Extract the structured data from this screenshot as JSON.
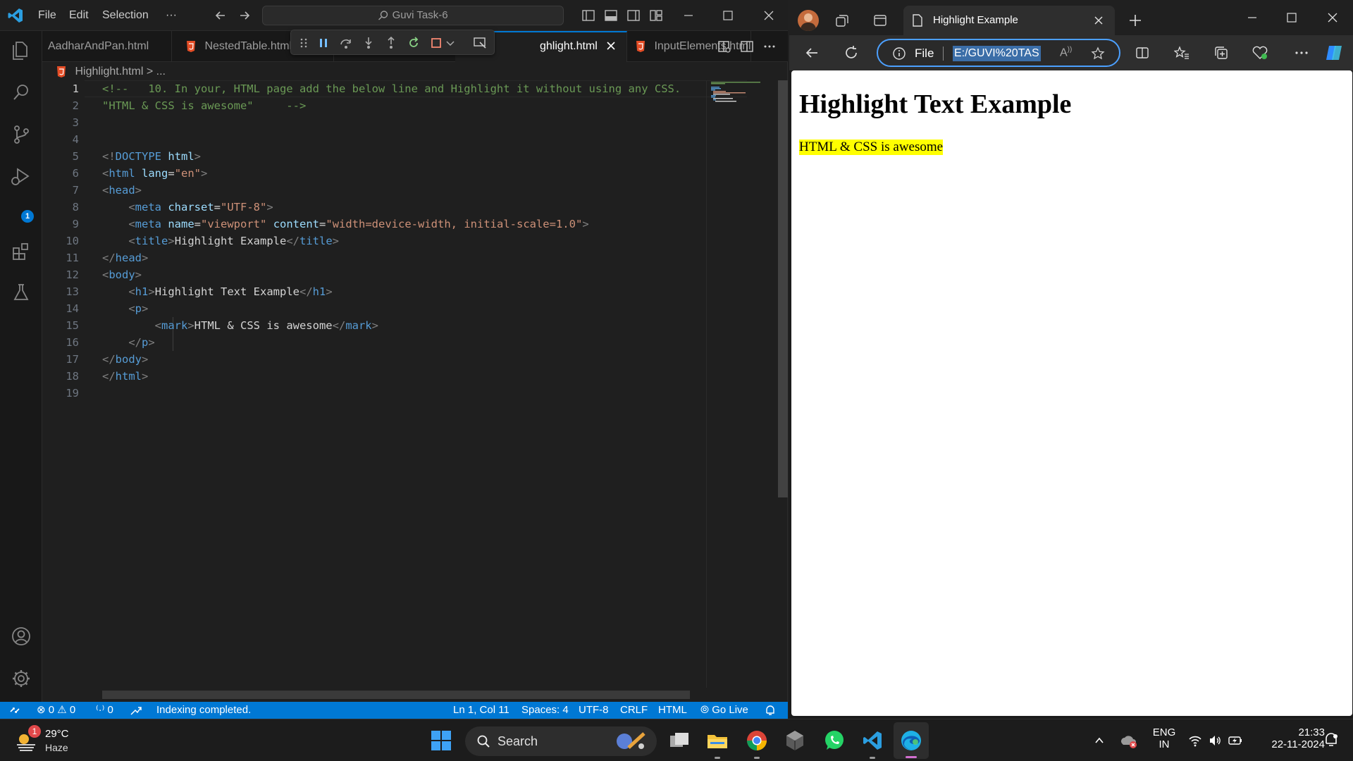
{
  "vscode": {
    "menu": [
      "File",
      "Edit",
      "Selection",
      "···"
    ],
    "command_center": "Guvi Task-6",
    "tabs": [
      {
        "label": "AadharAndPan.html",
        "active": false
      },
      {
        "label": "NestedTable.html",
        "active": false
      },
      {
        "label": "ghlight.html",
        "active": true
      },
      {
        "label": "InputElements.html",
        "active": false
      }
    ],
    "breadcrumb": {
      "file": "Highlight.html",
      "sep": ">",
      "more": "..."
    },
    "activity_badge": "1",
    "code_lines": [
      {
        "n": "1",
        "parts": [
          {
            "t": "<!--   10. In your, HTML page add the below line and Highlight it without using any CSS.",
            "c": "c-com"
          }
        ]
      },
      {
        "n": "2",
        "parts": [
          {
            "t": "\"HTML & CSS is awesome\"     -->",
            "c": "c-com"
          }
        ]
      },
      {
        "n": "3",
        "parts": []
      },
      {
        "n": "4",
        "parts": []
      },
      {
        "n": "5",
        "parts": [
          {
            "t": "<!",
            "c": "c-tag"
          },
          {
            "t": "DOCTYPE",
            "c": "c-name"
          },
          {
            "t": " ",
            "c": "c-txt"
          },
          {
            "t": "html",
            "c": "c-attr"
          },
          {
            "t": ">",
            "c": "c-tag"
          }
        ]
      },
      {
        "n": "6",
        "parts": [
          {
            "t": "<",
            "c": "c-tag"
          },
          {
            "t": "html",
            "c": "c-name"
          },
          {
            "t": " ",
            "c": "c-txt"
          },
          {
            "t": "lang",
            "c": "c-attr"
          },
          {
            "t": "=",
            "c": "c-txt"
          },
          {
            "t": "\"en\"",
            "c": "c-str"
          },
          {
            "t": ">",
            "c": "c-tag"
          }
        ]
      },
      {
        "n": "7",
        "parts": [
          {
            "t": "<",
            "c": "c-tag"
          },
          {
            "t": "head",
            "c": "c-name"
          },
          {
            "t": ">",
            "c": "c-tag"
          }
        ]
      },
      {
        "n": "8",
        "parts": [
          {
            "t": "    <",
            "c": "c-tag"
          },
          {
            "t": "meta",
            "c": "c-name"
          },
          {
            "t": " ",
            "c": "c-txt"
          },
          {
            "t": "charset",
            "c": "c-attr"
          },
          {
            "t": "=",
            "c": "c-txt"
          },
          {
            "t": "\"UTF-8\"",
            "c": "c-str"
          },
          {
            "t": ">",
            "c": "c-tag"
          }
        ]
      },
      {
        "n": "9",
        "parts": [
          {
            "t": "    <",
            "c": "c-tag"
          },
          {
            "t": "meta",
            "c": "c-name"
          },
          {
            "t": " ",
            "c": "c-txt"
          },
          {
            "t": "name",
            "c": "c-attr"
          },
          {
            "t": "=",
            "c": "c-txt"
          },
          {
            "t": "\"viewport\"",
            "c": "c-str"
          },
          {
            "t": " ",
            "c": "c-txt"
          },
          {
            "t": "content",
            "c": "c-attr"
          },
          {
            "t": "=",
            "c": "c-txt"
          },
          {
            "t": "\"width=device-width, initial-scale=1.0\"",
            "c": "c-str"
          },
          {
            "t": ">",
            "c": "c-tag"
          }
        ]
      },
      {
        "n": "10",
        "parts": [
          {
            "t": "    <",
            "c": "c-tag"
          },
          {
            "t": "title",
            "c": "c-name"
          },
          {
            "t": ">",
            "c": "c-tag"
          },
          {
            "t": "Highlight Example",
            "c": "c-txt"
          },
          {
            "t": "</",
            "c": "c-tag"
          },
          {
            "t": "title",
            "c": "c-name"
          },
          {
            "t": ">",
            "c": "c-tag"
          }
        ]
      },
      {
        "n": "11",
        "parts": [
          {
            "t": "</",
            "c": "c-tag"
          },
          {
            "t": "head",
            "c": "c-name"
          },
          {
            "t": ">",
            "c": "c-tag"
          }
        ]
      },
      {
        "n": "12",
        "parts": [
          {
            "t": "<",
            "c": "c-tag"
          },
          {
            "t": "body",
            "c": "c-name"
          },
          {
            "t": ">",
            "c": "c-tag"
          }
        ]
      },
      {
        "n": "13",
        "parts": [
          {
            "t": "    <",
            "c": "c-tag"
          },
          {
            "t": "h1",
            "c": "c-name"
          },
          {
            "t": ">",
            "c": "c-tag"
          },
          {
            "t": "Highlight Text Example",
            "c": "c-txt"
          },
          {
            "t": "</",
            "c": "c-tag"
          },
          {
            "t": "h1",
            "c": "c-name"
          },
          {
            "t": ">",
            "c": "c-tag"
          }
        ]
      },
      {
        "n": "14",
        "parts": [
          {
            "t": "    <",
            "c": "c-tag"
          },
          {
            "t": "p",
            "c": "c-name"
          },
          {
            "t": ">",
            "c": "c-tag"
          }
        ]
      },
      {
        "n": "15",
        "parts": [
          {
            "t": "        <",
            "c": "c-tag"
          },
          {
            "t": "mark",
            "c": "c-name"
          },
          {
            "t": ">",
            "c": "c-tag"
          },
          {
            "t": "HTML & CSS is awesome",
            "c": "c-txt"
          },
          {
            "t": "</",
            "c": "c-tag"
          },
          {
            "t": "mark",
            "c": "c-name"
          },
          {
            "t": ">",
            "c": "c-tag"
          }
        ]
      },
      {
        "n": "16",
        "parts": [
          {
            "t": "    </",
            "c": "c-tag"
          },
          {
            "t": "p",
            "c": "c-name"
          },
          {
            "t": ">",
            "c": "c-tag"
          }
        ]
      },
      {
        "n": "17",
        "parts": [
          {
            "t": "</",
            "c": "c-tag"
          },
          {
            "t": "body",
            "c": "c-name"
          },
          {
            "t": ">",
            "c": "c-tag"
          }
        ]
      },
      {
        "n": "18",
        "parts": [
          {
            "t": "</",
            "c": "c-tag"
          },
          {
            "t": "html",
            "c": "c-name"
          },
          {
            "t": ">",
            "c": "c-tag"
          }
        ]
      },
      {
        "n": "19",
        "parts": []
      }
    ],
    "status": {
      "errors": "0",
      "warnings": "0",
      "ports": "0",
      "message": "Indexing completed.",
      "position": "Ln 1, Col 11",
      "spaces": "Spaces: 4",
      "encoding": "UTF-8",
      "eol": "CRLF",
      "language": "HTML",
      "golive": "Go Live"
    }
  },
  "edge": {
    "tab_title": "Highlight Example",
    "address_prefix": "File",
    "address_url": "E:/GUVI%20TAS",
    "page": {
      "heading": "Highlight Text Example",
      "highlight": "HTML & CSS is awesome"
    }
  },
  "taskbar": {
    "weather_temp": "29°C",
    "weather_desc": "Haze",
    "weather_badge": "1",
    "search_label": "Search",
    "lang_line1": "ENG",
    "lang_line2": "IN",
    "time": "21:33",
    "date": "22-11-2024"
  },
  "colors": {
    "statusbar": "#0078d4",
    "highlight": "#ffff00",
    "comment": "#6a9955",
    "tag_name": "#569cd6",
    "attribute": "#9cdcfe",
    "string": "#ce9178"
  }
}
